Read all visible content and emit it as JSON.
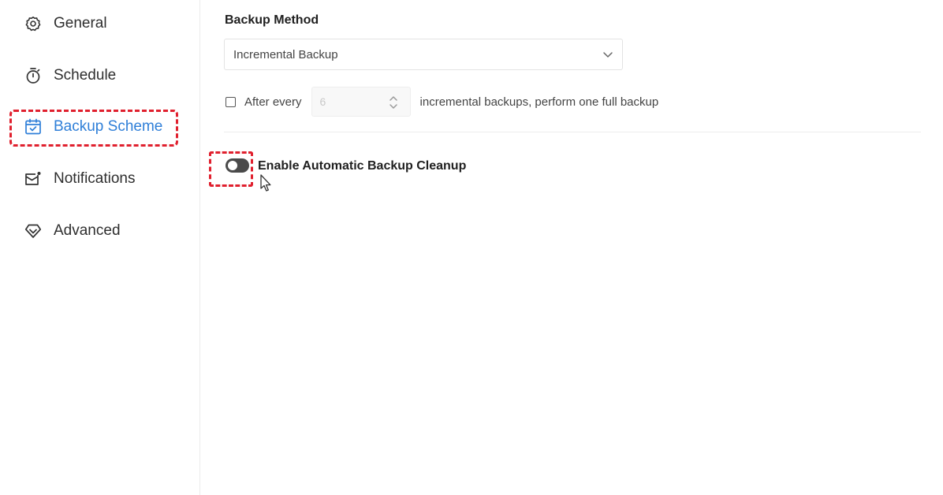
{
  "sidebar": {
    "items": [
      {
        "label": "General",
        "icon": "gear-icon"
      },
      {
        "label": "Schedule",
        "icon": "stopwatch-icon"
      },
      {
        "label": "Backup Scheme",
        "icon": "calendar-icon",
        "active": true
      },
      {
        "label": "Notifications",
        "icon": "mail-icon"
      },
      {
        "label": "Advanced",
        "icon": "diamond-icon"
      }
    ]
  },
  "backup_method": {
    "title": "Backup Method",
    "selected": "Incremental Backup"
  },
  "full_backup_rule": {
    "prefix": "After every",
    "value": "6",
    "suffix": "incremental backups, perform one full backup",
    "checked": false
  },
  "cleanup": {
    "label": "Enable Automatic Backup Cleanup",
    "enabled": false
  },
  "colors": {
    "accent": "#2f7fd8",
    "highlight": "#e0202e",
    "toggle_off": "#4a4a4a"
  }
}
